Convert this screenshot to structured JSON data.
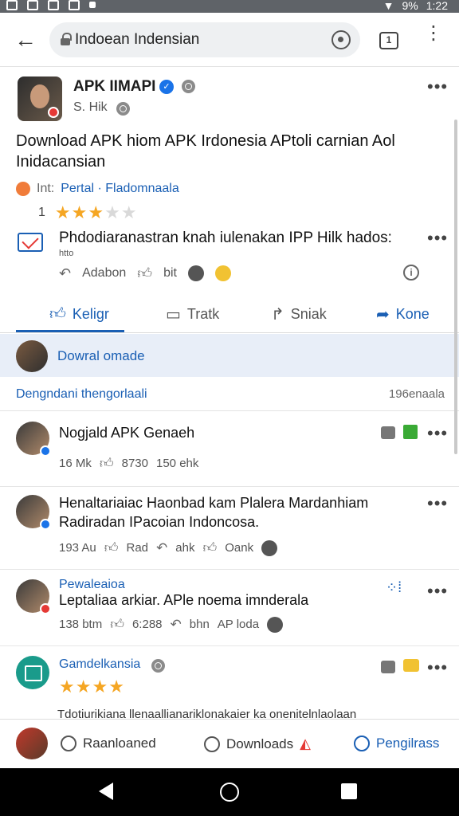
{
  "status": {
    "battery": "9%",
    "time": "1:22"
  },
  "url_bar": {
    "url": "Indoean Indensian"
  },
  "post": {
    "author": "APK IIMAPI",
    "meta": "S. Hik",
    "title": "Download APK hiom APK Irdonesia APtoli carnian Aol Inidacansian",
    "category_label": "Int:",
    "category_link": "Pertal · Fladomnaala",
    "rating_count": "1",
    "rating": 3,
    "rating_max": 5
  },
  "notice": {
    "text": "Phdodiaranastran knah iulenakan IPP Hilk hados:",
    "sub": "htto"
  },
  "mini_actions": {
    "a": "Adabon",
    "b": "bit"
  },
  "actions": [
    {
      "label": "Keligr",
      "icon": "like-icon"
    },
    {
      "label": "Tratk",
      "icon": "comment-icon"
    },
    {
      "label": "Sniak",
      "icon": "share-icon"
    },
    {
      "label": "Kone",
      "icon": "send-icon"
    }
  ],
  "download_banner": {
    "text": "Dowral omade"
  },
  "section": {
    "title": "Dengndani thengorlaali",
    "count": "196enaala"
  },
  "items": [
    {
      "title": "Nogjald APK Genaeh",
      "stats": [
        "16 Mk",
        "8730",
        "150 ehk"
      ]
    },
    {
      "title": "Henaltariaiac Haonbad kam Plalera Mardanhiam Radiradan IPacoian Indoncosa.",
      "stats": [
        "193 Au",
        "Rad",
        "ahk",
        "Oank"
      ]
    },
    {
      "kicker": "Pewaleaioa",
      "title": "Leptaliaa arkiar. APle noema imnderala",
      "stats": [
        "138 btm",
        "6:288",
        "bhn",
        "AP loda"
      ]
    },
    {
      "kicker": "Gamdelkansia",
      "rating": 3.5
    }
  ],
  "bottom_text": "Tdotiurikiana llenaallianariklonakaier ka onenitelnlaolaan",
  "bottom_bar": [
    {
      "label": "Raanloaned"
    },
    {
      "label": "Downloads"
    },
    {
      "label": "Pengilrass"
    }
  ]
}
